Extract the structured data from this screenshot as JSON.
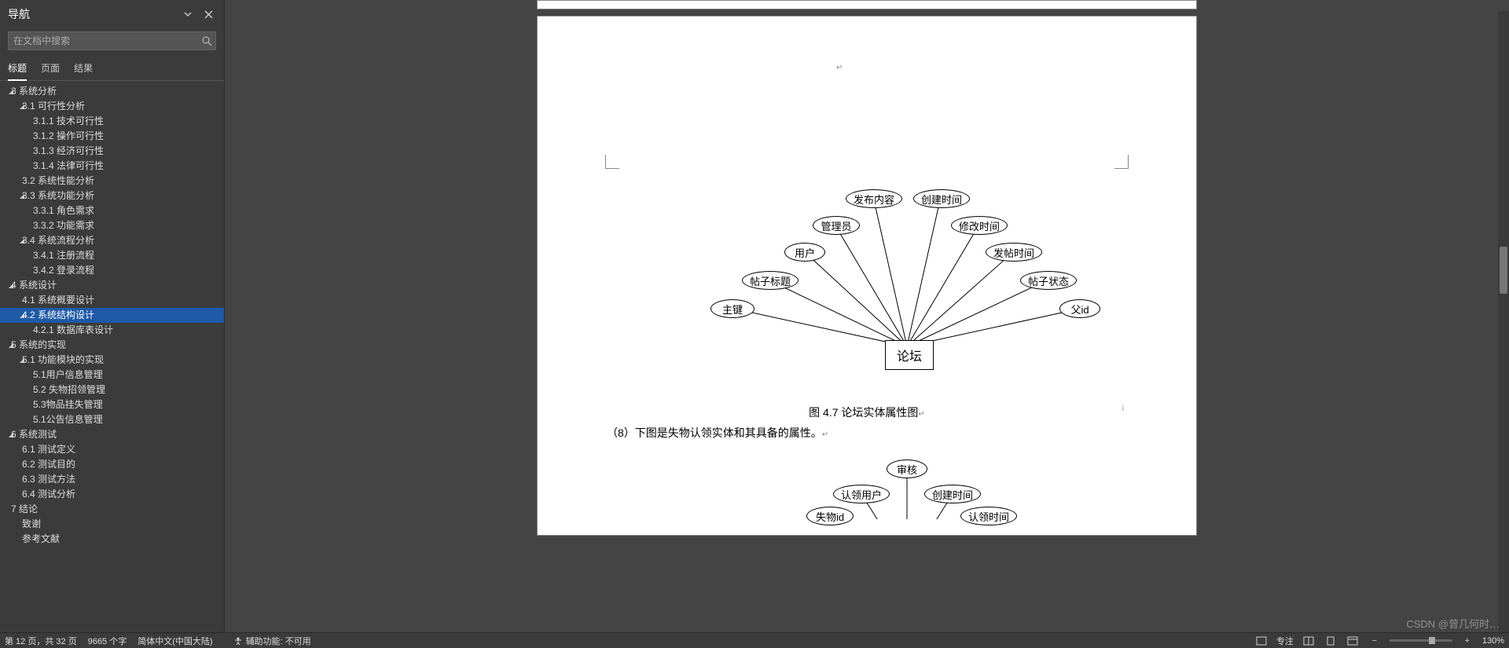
{
  "nav": {
    "title": "导航",
    "search_placeholder": "在文档中搜索",
    "tabs": [
      "标题",
      "页面",
      "结果"
    ],
    "active_tab": 0,
    "outline": [
      {
        "level": 0,
        "expand": "open",
        "label": "3 系统分析"
      },
      {
        "level": 1,
        "expand": "open",
        "label": "3.1 可行性分析"
      },
      {
        "level": 2,
        "expand": "none",
        "label": "3.1.1 技术可行性"
      },
      {
        "level": 2,
        "expand": "none",
        "label": "3.1.2 操作可行性"
      },
      {
        "level": 2,
        "expand": "none",
        "label": "3.1.3 经济可行性"
      },
      {
        "level": 2,
        "expand": "none",
        "label": "3.1.4 法律可行性"
      },
      {
        "level": 1,
        "expand": "none",
        "label": "3.2 系统性能分析"
      },
      {
        "level": 1,
        "expand": "open",
        "label": "3.3 系统功能分析"
      },
      {
        "level": 2,
        "expand": "none",
        "label": "3.3.1 角色需求"
      },
      {
        "level": 2,
        "expand": "none",
        "label": "3.3.2 功能需求"
      },
      {
        "level": 1,
        "expand": "open",
        "label": "3.4 系统流程分析"
      },
      {
        "level": 2,
        "expand": "none",
        "label": "3.4.1 注册流程"
      },
      {
        "level": 2,
        "expand": "none",
        "label": "3.4.2 登录流程"
      },
      {
        "level": 0,
        "expand": "open",
        "label": "4 系统设计"
      },
      {
        "level": 1,
        "expand": "none",
        "label": "4.1 系统概要设计"
      },
      {
        "level": 1,
        "expand": "open",
        "label": "4.2 系统结构设计",
        "selected": true
      },
      {
        "level": 2,
        "expand": "none",
        "label": "4.2.1 数据库表设计"
      },
      {
        "level": 0,
        "expand": "open",
        "label": "5 系统的实现"
      },
      {
        "level": 1,
        "expand": "open",
        "label": "5.1 功能模块的实现"
      },
      {
        "level": 2,
        "expand": "none",
        "label": "5.1用户信息管理"
      },
      {
        "level": 2,
        "expand": "none",
        "label": "5.2 失物招领管理"
      },
      {
        "level": 2,
        "expand": "none",
        "label": "5.3物品挂失管理"
      },
      {
        "level": 2,
        "expand": "none",
        "label": "5.1公告信息管理"
      },
      {
        "level": 0,
        "expand": "open",
        "label": "6 系统测试"
      },
      {
        "level": 1,
        "expand": "none",
        "label": "6.1 测试定义"
      },
      {
        "level": 1,
        "expand": "none",
        "label": "6.2 测试目的"
      },
      {
        "level": 1,
        "expand": "none",
        "label": "6.3 测试方法"
      },
      {
        "level": 1,
        "expand": "none",
        "label": "6.4 测试分析"
      },
      {
        "level": 0,
        "expand": "none",
        "label": "7 结论"
      },
      {
        "level": 0,
        "expand": "none",
        "label": "致谢",
        "noindent": true
      },
      {
        "level": 0,
        "expand": "none",
        "label": "参考文献",
        "noindent": true
      }
    ]
  },
  "doc": {
    "diagram1": {
      "center": "论坛",
      "nodes": [
        "主键",
        "帖子标题",
        "用户",
        "管理员",
        "发布内容",
        "创建时间",
        "修改时间",
        "发帖时间",
        "帖子状态",
        "父id"
      ],
      "caption": "图 4.7 论坛实体属性图",
      "body": "（8）下图是失物认领实体和其具备的属性。"
    },
    "diagram2": {
      "nodes": [
        "审核",
        "认领用户",
        "创建时间",
        "失物id",
        "认领时间"
      ]
    }
  },
  "status": {
    "page": "第 12 页，共 32 页",
    "words": "9665 个字",
    "lang": "简体中文(中国大陆)",
    "acc": "辅助功能: 不可用",
    "focus": "专注",
    "zoom": "130%"
  },
  "watermark": "CSDN @曾几何时…"
}
